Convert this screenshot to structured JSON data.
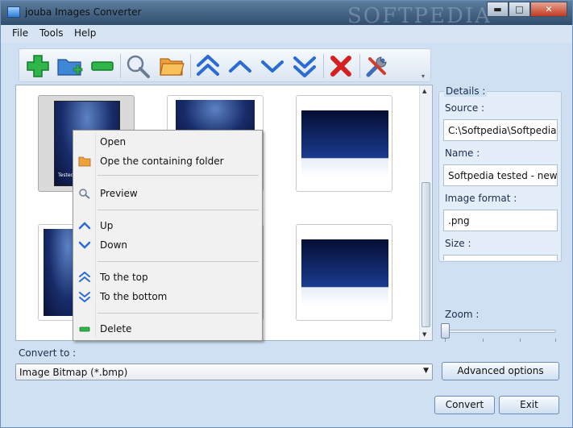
{
  "window": {
    "title": "jouba Images Converter",
    "watermark": "SOFTPEDIA",
    "min_glyph": "▬",
    "max_glyph": "□",
    "close_glyph": "✕"
  },
  "menu": {
    "file": "File",
    "tools": "Tools",
    "help": "Help"
  },
  "toolbar": {
    "icons": [
      "add-icon",
      "add-folder-icon",
      "remove-icon",
      "preview-icon",
      "open-folder-icon",
      "to-top-icon",
      "up-icon",
      "down-icon",
      "to-bottom-icon",
      "delete-icon",
      "settings-icon"
    ]
  },
  "thumbnails": [
    {
      "selected": true,
      "caption": "Tested by Softpedia"
    },
    {
      "selected": false
    },
    {
      "selected": false
    },
    {
      "selected": false
    },
    {
      "selected": false
    },
    {
      "selected": false
    }
  ],
  "context_menu": {
    "open": "Open",
    "open_folder": "Ope the containing folder",
    "preview": "Preview",
    "up": "Up",
    "down": "Down",
    "to_top": "To the top",
    "to_bottom": "To the bottom",
    "delete": "Delete"
  },
  "details": {
    "title": "Details :",
    "source_label": "Source :",
    "source_value": "C:\\Softpedia\\Softpedia te",
    "name_label": "Name :",
    "name_value": "Softpedia tested - new",
    "format_label": "Image format :",
    "format_value": ".png",
    "size_label": "Size :"
  },
  "zoom": {
    "label": "Zoom :",
    "level": 0
  },
  "convert": {
    "label": "Convert to :",
    "selected": "Image Bitmap (*.bmp)",
    "advanced": "Advanced options",
    "convert_btn": "Convert",
    "exit_btn": "Exit"
  },
  "colors": {
    "window_bg": "#cfe0f3",
    "accent_blue": "#2b6cd4",
    "delete_red": "#d62020",
    "add_green": "#27a33a"
  }
}
